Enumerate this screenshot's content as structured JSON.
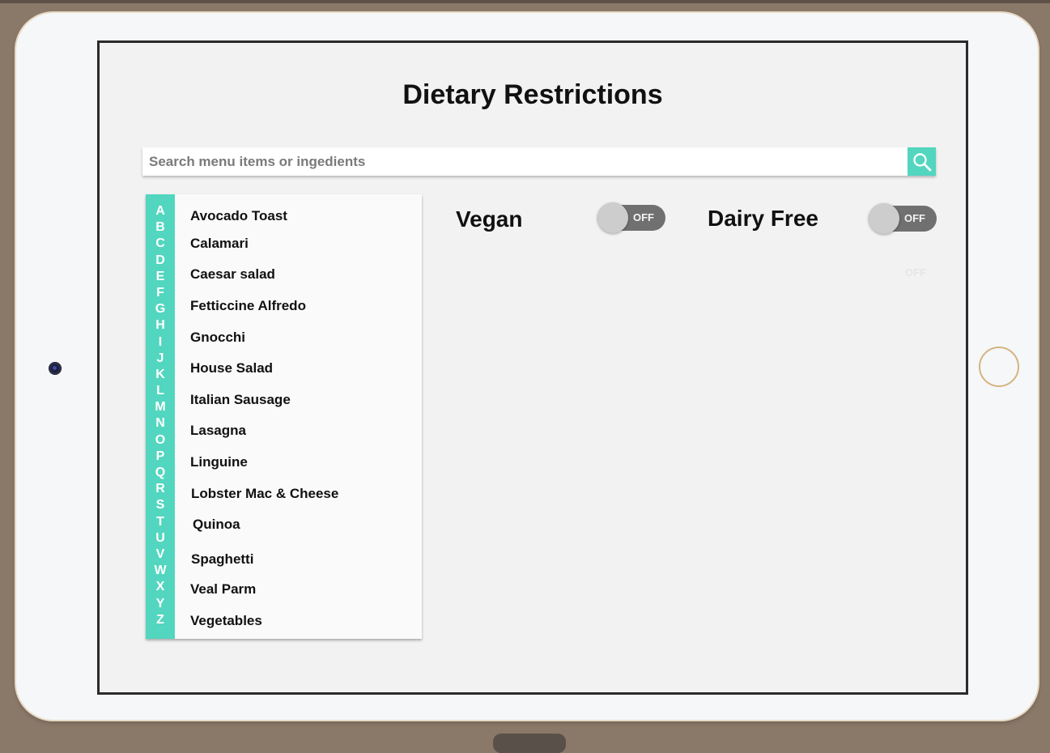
{
  "page_title": "Dietary Restrictions",
  "search": {
    "placeholder": "Search menu items or ingedients",
    "icon": "search-icon"
  },
  "alphabet": [
    "A",
    "B",
    "C",
    "D",
    "E",
    "F",
    "G",
    "H",
    "I",
    "J",
    "K",
    "L",
    "M",
    "N",
    "O",
    "P",
    "Q",
    "R",
    "S",
    "T",
    "U",
    "V",
    "W",
    "X",
    "Y",
    "Z"
  ],
  "menu_items": [
    "Avocado Toast",
    "Calamari",
    "Caesar salad",
    "Fetticcine Alfredo",
    "Gnocchi",
    "House Salad",
    "Italian Sausage",
    "Lasagna",
    "Linguine",
    "Lobster Mac & Cheese",
    "Quinoa",
    "Spaghetti",
    "Veal Parm",
    "Vegetables"
  ],
  "filters": {
    "vegan": {
      "label": "Vegan",
      "state": "OFF"
    },
    "dairy_free": {
      "label": "Dairy Free",
      "state": "OFF"
    },
    "hidden_toggle_text": "OFF"
  },
  "colors": {
    "accent": "#52d6bf",
    "toggle_track": "#707070",
    "toggle_knob": "#cdcdcd",
    "device_frame": "#f6f7f9",
    "background": "#8a7868"
  }
}
